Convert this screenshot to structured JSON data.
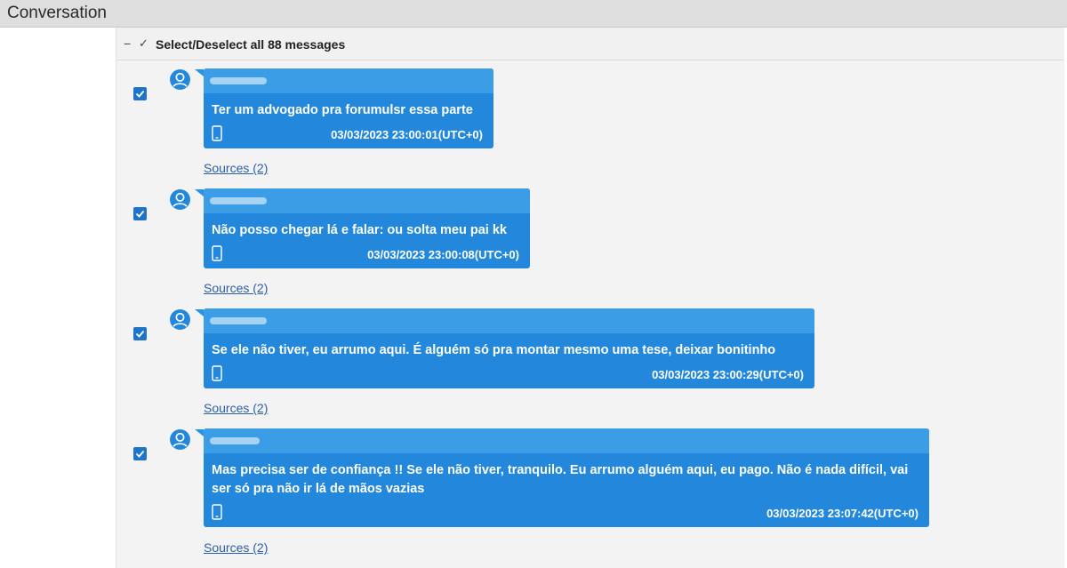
{
  "window": {
    "title": "Conversation"
  },
  "toolbar": {
    "collapse_glyph": "−",
    "check_glyph": "✓",
    "select_all_label": "Select/Deselect all 88 messages"
  },
  "messages": [
    {
      "text": "Ter um advogado pra forumulsr essa parte",
      "timestamp": "03/03/2023 23:00:01(UTC+0)",
      "sources": "Sources (2)",
      "checked": true,
      "device_icon": "mobile-phone-icon"
    },
    {
      "text": "Não posso chegar lá e falar: ou solta meu pai kk",
      "timestamp": "03/03/2023 23:00:08(UTC+0)",
      "sources": "Sources (2)",
      "checked": true,
      "device_icon": "mobile-phone-icon"
    },
    {
      "text": "Se ele não tiver, eu arrumo aqui. É alguém só pra montar mesmo uma tese, deixar bonitinho",
      "timestamp": "03/03/2023 23:00:29(UTC+0)",
      "sources": "Sources (2)",
      "checked": true,
      "device_icon": "mobile-phone-icon"
    },
    {
      "text": "Mas precisa ser de confiança !! Se ele não tiver, tranquilo. Eu arrumo alguém aqui, eu pago. Não é nada difícil, vai ser só pra não ir lá de mãos vazias",
      "timestamp": "03/03/2023 23:07:42(UTC+0)",
      "sources": "Sources (2)",
      "checked": true,
      "device_icon": "mobile-phone-icon"
    }
  ],
  "colors": {
    "bubble": "#2388dc",
    "bubble_header": "#3a9de6",
    "checkbox": "#1f74c7",
    "link": "#2a5fa8"
  }
}
